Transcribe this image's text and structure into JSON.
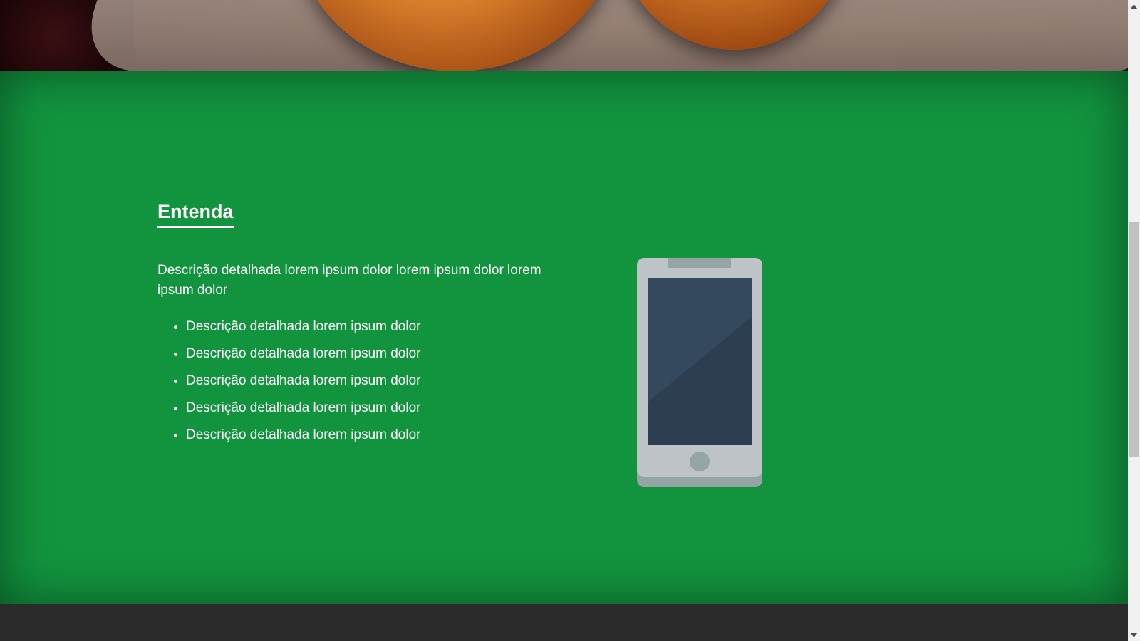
{
  "section": {
    "title": "Entenda",
    "description": "Descrição detalhada lorem ipsum dolor lorem ipsum dolor lorem ipsum dolor",
    "bullets": [
      "Descrição detalhada lorem ipsum dolor",
      "Descrição detalhada lorem ipsum dolor",
      "Descrição detalhada lorem ipsum dolor",
      "Descrição detalhada lorem ipsum dolor",
      "Descrição detalhada lorem ipsum dolor"
    ],
    "illustration_icon": "smartphone-icon"
  },
  "colors": {
    "section_background": "#12943f",
    "footer_background": "#2b2b2b",
    "text": "#ffffff",
    "phone_body": "#bdc3c7",
    "phone_screen": "#34495e"
  },
  "scrollbar": {
    "up_icon": "arrow-up-icon",
    "down_icon": "arrow-down-icon"
  }
}
